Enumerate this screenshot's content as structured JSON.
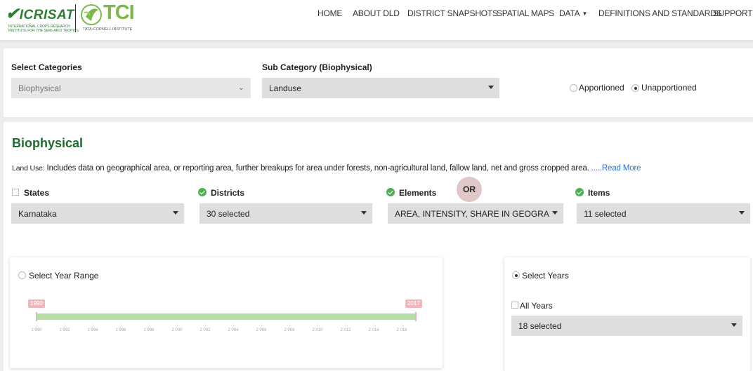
{
  "header": {
    "logo_icrisat": {
      "name": "ICRISAT",
      "tagline_1": "INTERNATIONAL CROPS RESEARCH",
      "tagline_2": "INSTITUTE FOR THE SEMI-ARID TROPICS"
    },
    "logo_tci": {
      "name": "TCI",
      "tagline": "TATA-CORNELL INSTITUTE"
    },
    "nav": [
      {
        "label": "HOME"
      },
      {
        "label": "ABOUT DLD"
      },
      {
        "label": "DISTRICT SNAPSHOTS"
      },
      {
        "label": "SPATIAL MAPS"
      },
      {
        "label": "DATA",
        "has_dropdown": true
      },
      {
        "label": "DEFINITIONS AND STANDARDS"
      },
      {
        "label": "SUPPORT"
      }
    ]
  },
  "filters": {
    "categories_label": "Select Categories",
    "categories_value": "Biophysical",
    "subcategory_label": "Sub Category (Biophysical)",
    "subcategory_value": "Landuse",
    "apportioned_label": "Apportioned",
    "unapportioned_label": "Unapportioned",
    "apportion_selected": "Unapportioned"
  },
  "section": {
    "title": "Biophysical",
    "desc_lead": "Land Use:",
    "desc_text": " Includes data on geographical area, or reporting area, further breakups for area under forests, non-agricultural land, fallow land, net and gross cropped area. ",
    "read_more": ".....Read More"
  },
  "selectors": {
    "states_label": "States",
    "states_value": "Karnataka",
    "districts_label": "Districts",
    "districts_value": "30 selected",
    "elements_label": "Elements",
    "elements_value": "AREA, INTENSITY, SHARE IN GEOGRAP...",
    "items_label": "Items",
    "items_value": "11 selected"
  },
  "year_range": {
    "label": "Select Year Range",
    "min_tag": "1990",
    "max_tag": "2017",
    "min_value": 1990,
    "max_value": 2017,
    "ticks": [
      "1 990",
      "1 992",
      "1 994",
      "1 996",
      "1 998",
      "2 000",
      "2 002",
      "2 004",
      "2 006",
      "2 008",
      "2 010",
      "2 012",
      "2 014",
      "2 016"
    ],
    "tick_values": [
      1990,
      1992,
      1994,
      1996,
      1998,
      2000,
      2002,
      2004,
      2006,
      2008,
      2010,
      2012,
      2014,
      2016
    ]
  },
  "or_label": "OR",
  "years": {
    "select_years_label": "Select Years",
    "all_years_label": "All Years",
    "years_value": "18 selected"
  },
  "colors": {
    "accent_green": "#1d6b2d",
    "link_blue": "#2a6fc9",
    "slider_fill": "#b6dda4",
    "slider_handle": "#efb7bc",
    "check_green": "#4caf50"
  }
}
